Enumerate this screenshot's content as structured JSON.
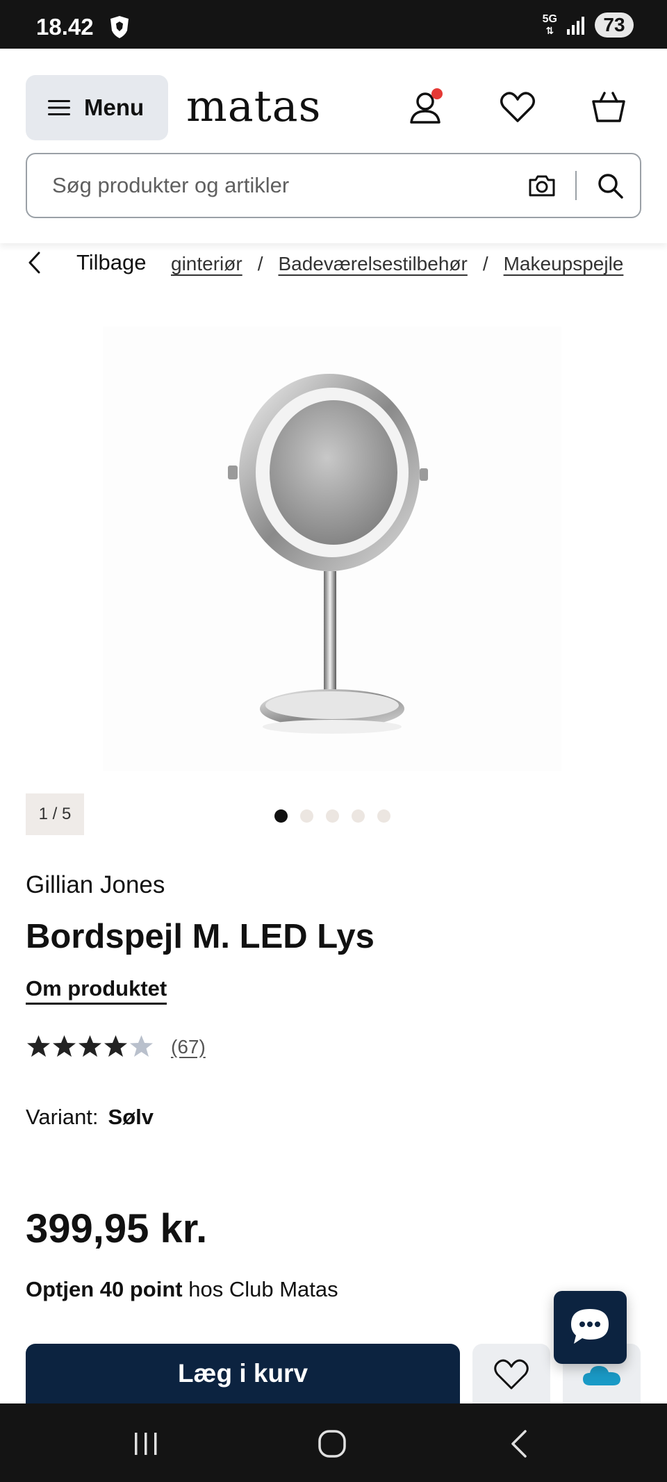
{
  "status_bar": {
    "time": "18.42",
    "network": "5G",
    "battery": "73"
  },
  "header": {
    "menu_label": "Menu",
    "logo": "matas",
    "search_placeholder": "Søg produkter og artikler"
  },
  "breadcrumb": {
    "back_label": "Tilbage",
    "items": [
      "ginteriør",
      "Badeværelsestilbehør",
      "Makeupspejle"
    ],
    "separator": "/"
  },
  "gallery": {
    "counter": "1 / 5",
    "total_dots": 5,
    "active_dot": 0
  },
  "product": {
    "brand": "Gillian Jones",
    "title": "Bordspejl M. LED Lys",
    "about_link": "Om produktet",
    "rating": 4,
    "rating_max": 5,
    "review_count": "(67)",
    "variant_label": "Variant:",
    "variant_value": "Sølv",
    "price": "399,95 kr.",
    "points_bold": "Optjen 40 point",
    "points_rest": " hos Club Matas"
  },
  "actions": {
    "add_to_cart": "Læg i kurv"
  },
  "colors": {
    "primary": "#0c2340",
    "notification": "#e53935",
    "cloud": "#1a9ac6",
    "light_button": "#eceef1"
  }
}
